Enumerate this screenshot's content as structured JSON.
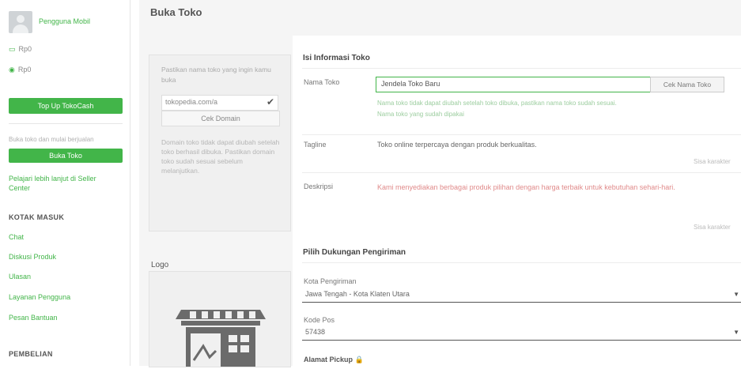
{
  "sidebar": {
    "user_name": "Pengguna Mobil",
    "stat1": "Rp0",
    "stat2": "Rp0",
    "topup_label": "Top Up TokoCash",
    "open_shop_text": "Buka toko dan mulai berjualan",
    "open_shop_button": "Buka Toko",
    "shop_link": "Pelajari lebih lanjut di Seller Center",
    "section1_title": "KOTAK MASUK",
    "section1_items": [
      "Chat",
      "Diskusi Produk",
      "Ulasan",
      "Layanan Pengguna",
      "Pesan Bantuan"
    ],
    "section2_title": "PEMBELIAN"
  },
  "page": {
    "title": "Buka Toko"
  },
  "tips": {
    "text1": "Pastikan nama toko yang ingin kamu buka",
    "domain_value": "tokopedia.com/a",
    "check_button": "Cek Domain",
    "text2": "Domain toko tidak dapat diubah setelah toko berhasil dibuka. Pastikan domain toko sudah sesuai sebelum melanjutkan."
  },
  "form": {
    "section_title": "Isi Informasi Toko",
    "name_label": "Nama Toko",
    "name_value": "Jendela Toko Baru",
    "check_button": "Cek Nama Toko",
    "name_help1": "Nama toko tidak dapat diubah setelah toko dibuka, pastikan nama toko sudah sesuai.",
    "name_help2": "Nama toko yang sudah dipakai",
    "tagline_label": "Tagline",
    "tagline_value": "Toko online terpercaya dengan produk berkualitas.",
    "tagline_counter": "Sisa karakter",
    "desc_label": "Deskripsi",
    "desc_value": "Kami menyediakan berbagai produk pilihan dengan harga terbaik untuk kebutuhan sehari-hari.",
    "desc_counter": "Sisa karakter",
    "shipping_title": "Pilih Dukungan Pengiriman",
    "city_label": "Kota Pengiriman",
    "city_value": "Jawa Tengah - Kota Klaten Utara",
    "postal_label": "Kode Pos",
    "postal_value": "57438",
    "pickup_label": "Alamat Pickup"
  },
  "logo": {
    "title": "Logo"
  },
  "colors": {
    "accent": "#42b549"
  }
}
